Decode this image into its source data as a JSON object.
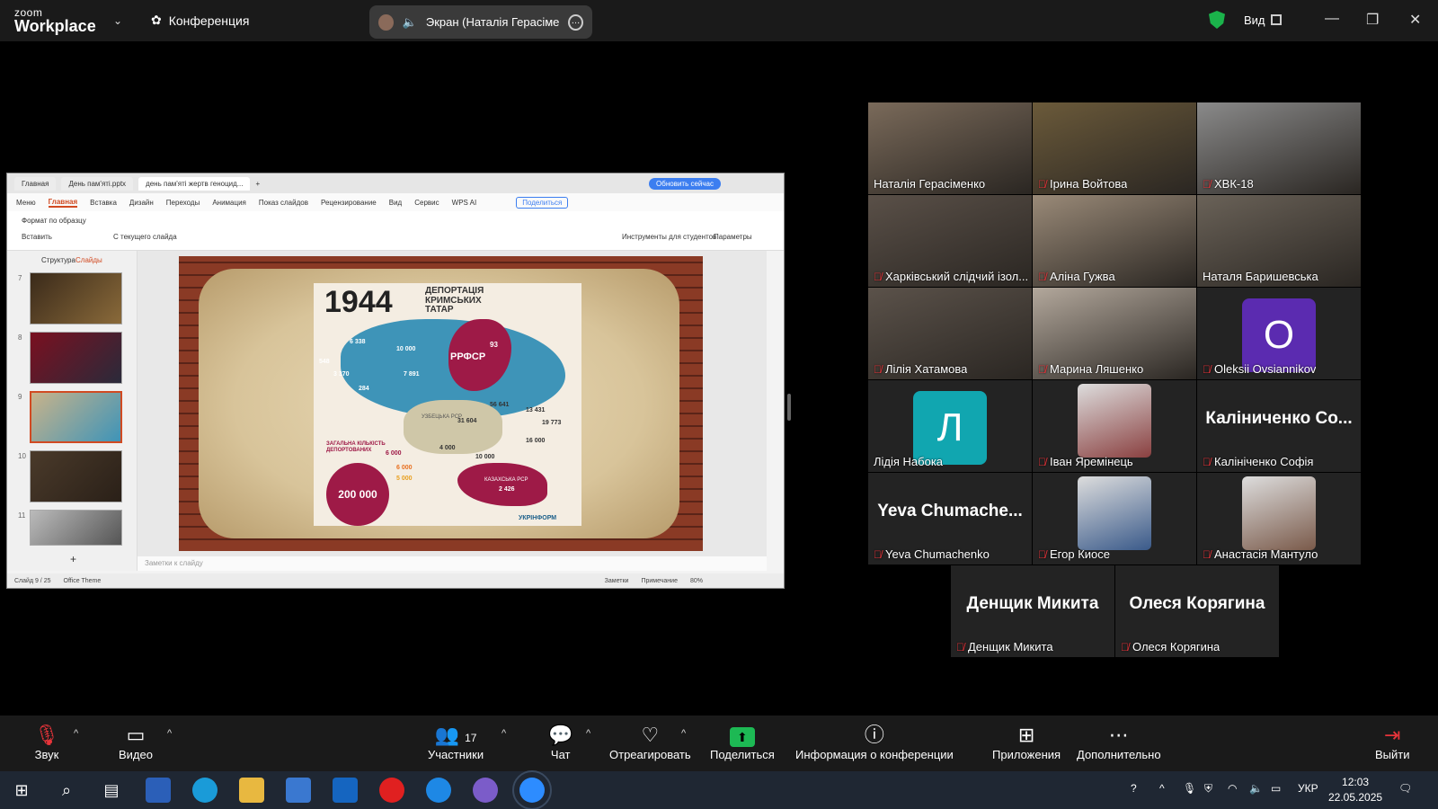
{
  "app": {
    "logo_small": "zoom",
    "logo_big": "Workplace",
    "meeting_label": "Конференция"
  },
  "share_pill": {
    "label": "Экран (Наталія Герасіменко)"
  },
  "header_right": {
    "view_label": "Вид"
  },
  "shared_window": {
    "tabs": [
      "Главная",
      "День пам'яті.pptx",
      "день пам'яті жертв геноцид..."
    ],
    "update_button": "Обновить сейчас",
    "menu": [
      "Меню",
      "Главная",
      "Вставка",
      "Дизайн",
      "Переходы",
      "Анимация",
      "Показ слайдов",
      "Рецензирование",
      "Вид",
      "Сервис",
      "WPS AI"
    ],
    "share_btn": "Поделиться",
    "ribbon": {
      "format_painter": "Формат по образцу",
      "paste": "Вставить",
      "from_current": "С текущего слайда",
      "tools": "Инструменты для студентов",
      "params": "Параметры"
    },
    "panel_tabs": [
      "Структура",
      "Слайды"
    ],
    "thumb_numbers": [
      "7",
      "8",
      "9",
      "10",
      "11"
    ],
    "slide": {
      "year": "1944",
      "title_line1": "ДЕПОРТАЦІЯ",
      "title_line2": "КРИМСЬКИХ",
      "title_line3": "ТАТАР",
      "rsfsr": "РРФСР",
      "uzb": "УЗБЕЦЬКА РСР",
      "kaz": "КАЗАХСЬКА РСР",
      "kaz_val": "2 426",
      "total_label": "ЗАГАЛЬНА КІЛЬКІСТЬ ДЕПОРТОВАНИХ",
      "total_value": "200 000",
      "source": "УКРІНФОРМ",
      "numbers": [
        "93",
        "10 000",
        "6 338",
        "548",
        "3 370",
        "7 891",
        "284",
        "56 641",
        "13 431",
        "31 604",
        "19 773",
        "4 000",
        "10 000",
        "16 000",
        "6 000",
        "6 000",
        "5 000"
      ]
    },
    "notes_placeholder": "Заметки к слайду",
    "status": {
      "slide_count": "Слайд 9 / 25",
      "theme": "Office Theme",
      "notes": "Заметки",
      "comment": "Примечание",
      "zoom": "80%"
    }
  },
  "participants": [
    {
      "name": "Наталія Герасіменко",
      "muted": false,
      "kind": "video",
      "color": "#7a6a5a"
    },
    {
      "name": "Ірина Войтова",
      "muted": true,
      "kind": "video",
      "color": "#6b5a3a"
    },
    {
      "name": "ХВК-18",
      "muted": true,
      "kind": "video",
      "color": "#8a8a8a"
    },
    {
      "name": "Харківський слідчий ізол...",
      "muted": true,
      "kind": "video",
      "color": "#5a5048"
    },
    {
      "name": "Аліна Гужва",
      "muted": true,
      "kind": "video",
      "color": "#9a8a78"
    },
    {
      "name": "Наталя Баришевська",
      "muted": false,
      "kind": "video",
      "color": "#6a6258",
      "active": true
    },
    {
      "name": "Лілія Хатамова",
      "muted": true,
      "kind": "video",
      "color": "#5b524a"
    },
    {
      "name": "Марина Ляшенко",
      "muted": true,
      "kind": "video",
      "color": "#b3a89c"
    },
    {
      "name": "Oleksii Ovsiannikov",
      "muted": true,
      "kind": "avatar",
      "letter": "O",
      "color": "#5b2bb0"
    },
    {
      "name": "Лідія Набока",
      "muted": false,
      "kind": "avatar",
      "letter": "Л",
      "color": "#11a6b0"
    },
    {
      "name": "Іван Яремінець",
      "muted": true,
      "kind": "photo",
      "color": "#8a4040"
    },
    {
      "name": "Калініченко Софія",
      "muted": true,
      "kind": "text",
      "display": "Каліниченко Со..."
    },
    {
      "name": "Yeva Chumachenko",
      "muted": true,
      "kind": "text",
      "display": "Yeva  Chumache..."
    },
    {
      "name": "Егор Киосе",
      "muted": true,
      "kind": "photo",
      "color": "#3a5a8a"
    },
    {
      "name": "Анастасія Мантуло",
      "muted": true,
      "kind": "photo",
      "color": "#7a5a4a"
    },
    {
      "name": "Денщик Микита",
      "muted": true,
      "kind": "text",
      "display": "Денщик Микита"
    },
    {
      "name": "Олеся Корягина",
      "muted": true,
      "kind": "text",
      "display": "Олеся Корягина"
    }
  ],
  "toolbar": {
    "audio": "Звук",
    "video": "Видео",
    "participants": "Участники",
    "participants_count": "17",
    "chat": "Чат",
    "react": "Отреагировать",
    "share": "Поделиться",
    "info": "Информация о конференции",
    "apps": "Приложения",
    "more": "Дополнительно",
    "leave": "Выйти"
  },
  "taskbar": {
    "lang": "УКР",
    "time": "12:03",
    "date": "22.05.2025"
  }
}
